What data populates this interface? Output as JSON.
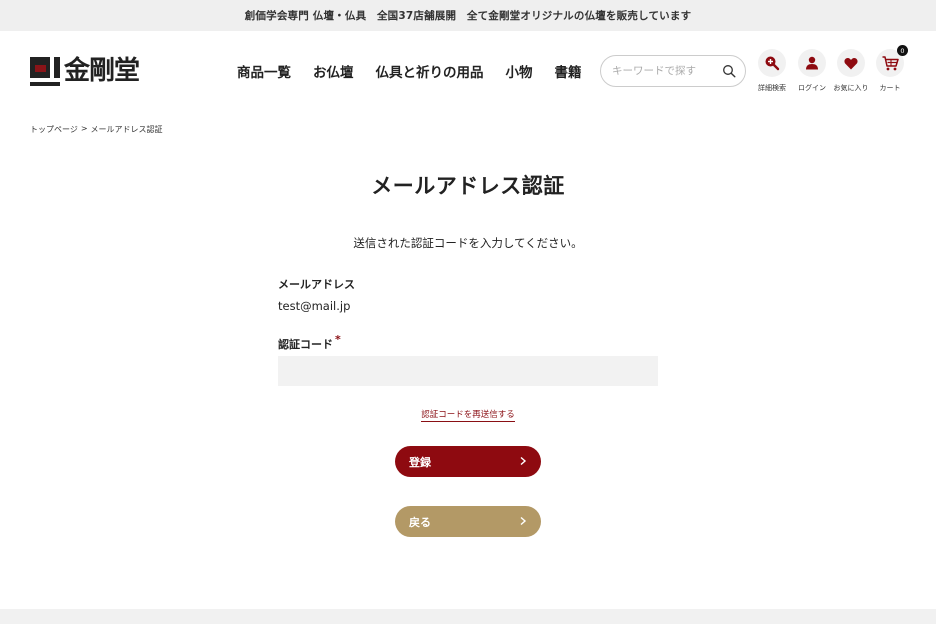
{
  "announcement": "創価学会専門 仏壇・仏具　全国37店舗展開　全て金剛堂オリジナルの仏壇を販売しています",
  "logo": {
    "text": "金剛堂"
  },
  "nav": [
    {
      "label": "商品一覧"
    },
    {
      "label": "お仏壇"
    },
    {
      "label": "仏具と祈りの用品"
    },
    {
      "label": "小物"
    },
    {
      "label": "書籍"
    }
  ],
  "search": {
    "placeholder": "キーワードで探す",
    "value": ""
  },
  "header_icons": {
    "detail_search": {
      "label": "詳細検索",
      "icon": "search-plus-icon"
    },
    "login": {
      "label": "ログイン",
      "icon": "user-icon"
    },
    "favorites": {
      "label": "お気に入り",
      "icon": "heart-icon"
    },
    "cart": {
      "label": "カート",
      "icon": "cart-icon",
      "count": "0"
    }
  },
  "breadcrumb": {
    "home": "トップページ",
    "separator": ">",
    "current": "メールアドレス認証"
  },
  "page_title": "メールアドレス認証",
  "instruction": "送信された認証コードを入力してください。",
  "form": {
    "email_label": "メールアドレス",
    "email_value": "test@mail.jp",
    "code_label": "認証コード",
    "required_mark": "*",
    "code_value": "",
    "resend_link": "認証コードを再送信する"
  },
  "buttons": {
    "register": "登録",
    "back": "戻る"
  },
  "colors": {
    "accent": "#8e0a10",
    "back_button": "#b39966",
    "topbar_bg": "#efefef"
  }
}
